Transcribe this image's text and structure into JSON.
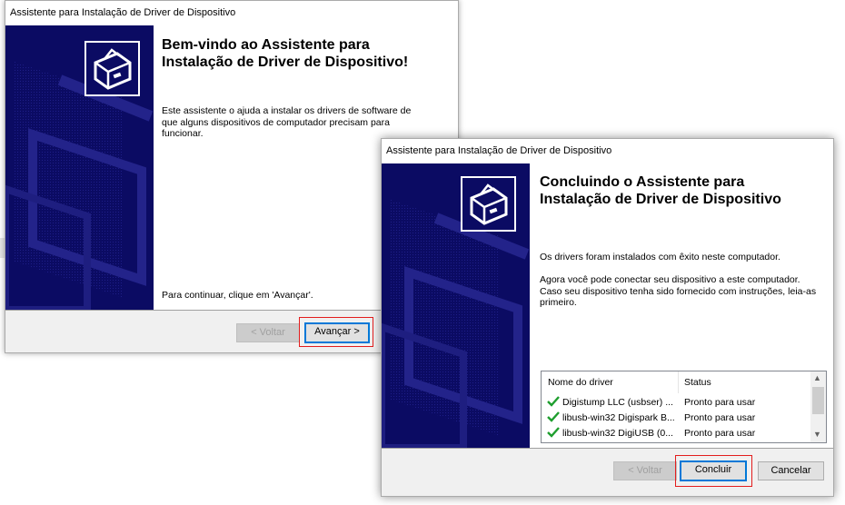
{
  "dialog1": {
    "title": "Assistente para Instalação de Driver de Dispositivo",
    "heading_line1": "Bem-vindo ao Assistente para",
    "heading_line2": "Instalação de Driver de Dispositivo!",
    "intro_line1": "Este assistente o ajuda a instalar os drivers de software de",
    "intro_line2": "que alguns dispositivos de computador precisam para",
    "intro_line3": "funcionar.",
    "continue_text": "Para continuar, clique em 'Avançar'.",
    "back_label": "< Voltar",
    "next_label": "Avançar >",
    "icon": "hardware-install-icon"
  },
  "dialog2": {
    "title": "Assistente para Instalação de Driver de Dispositivo",
    "heading_line1": "Concluindo o Assistente para",
    "heading_line2": "Instalação de Driver de Dispositivo",
    "success_text": "Os drivers foram instalados com êxito neste computador.",
    "connect_line1": "Agora você pode conectar seu dispositivo a este computador.",
    "connect_line2": "Caso seu dispositivo tenha sido fornecido com instruções, leia-as",
    "connect_line3": "primeiro.",
    "table": {
      "col_driver": "Nome do driver",
      "col_status": "Status",
      "rows": [
        {
          "name": "Digistump LLC (usbser) ...",
          "status": "Pronto para usar"
        },
        {
          "name": "libusb-win32 Digispark B...",
          "status": "Pronto para usar"
        },
        {
          "name": "libusb-win32 DigiUSB (0...",
          "status": "Pronto para usar"
        }
      ]
    },
    "back_label": "< Voltar",
    "finish_label": "Concluir",
    "cancel_label": "Cancelar",
    "icon": "hardware-install-icon"
  },
  "colors": {
    "banner": "#0b0b63",
    "highlight": "#e31d1d",
    "focus": "#0078d7",
    "check": "#1e9e2e"
  }
}
